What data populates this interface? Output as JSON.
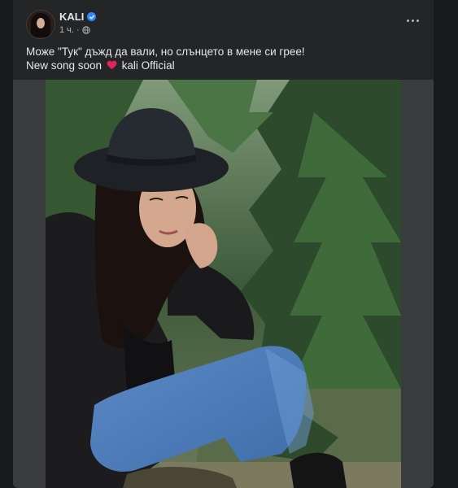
{
  "post": {
    "author": "KALI",
    "verified_icon": "verified-badge-icon",
    "time": "1 ч.",
    "separator": "·",
    "audience_icon": "globe-icon",
    "more_icon": "more-options-icon",
    "text_line1": "Може \"Тук\" дъжд да вали, но слънцето в мене си грее!",
    "text_line2_before": "New song soon",
    "text_line2_emoji": "heart-icon",
    "text_line2_after": "kali Official",
    "photo": "photo of woman in black hat sitting in front of fir trees"
  },
  "colors": {
    "background": "#18191a",
    "card": "#242526",
    "primary_text": "#e4e6eb",
    "secondary_text": "#b0b3b8",
    "verified": "#2d88ff",
    "heart": "#e0245e"
  }
}
